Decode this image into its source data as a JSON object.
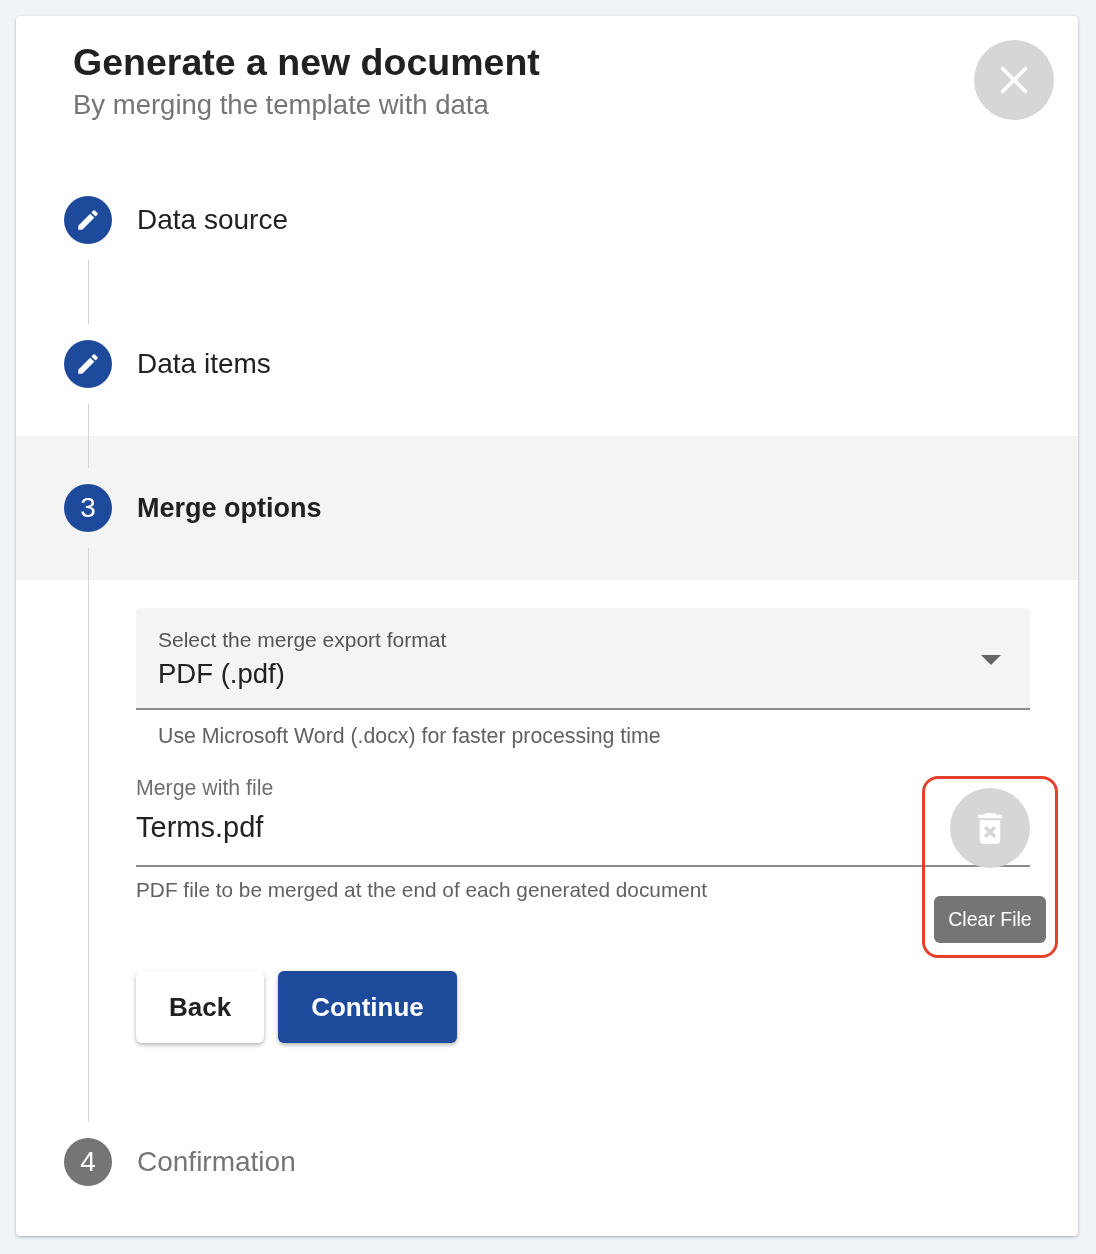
{
  "dialog": {
    "title": "Generate a new document",
    "subtitle": "By merging the template with data"
  },
  "steps": [
    {
      "kind": "edit",
      "label": "Data source",
      "selected": false,
      "disabled": false
    },
    {
      "kind": "edit",
      "label": "Data items",
      "selected": false,
      "disabled": false
    },
    {
      "kind": "number",
      "number": "3",
      "label": "Merge options",
      "selected": true,
      "disabled": false
    },
    {
      "kind": "number",
      "number": "4",
      "label": "Confirmation",
      "selected": false,
      "disabled": true
    }
  ],
  "merge_options": {
    "format_select": {
      "label": "Select the merge export format",
      "value": "PDF (.pdf)",
      "hint": "Use Microsoft Word (.docx) for faster processing time"
    },
    "file_field": {
      "label": "Merge with file",
      "value": "Terms.pdf",
      "hint": "PDF file to be merged at the end of each generated document",
      "clear_tooltip": "Clear File",
      "highlighted": true
    },
    "buttons": [
      {
        "label": "Back",
        "kind": "secondary"
      },
      {
        "label": "Continue",
        "kind": "primary"
      }
    ]
  }
}
